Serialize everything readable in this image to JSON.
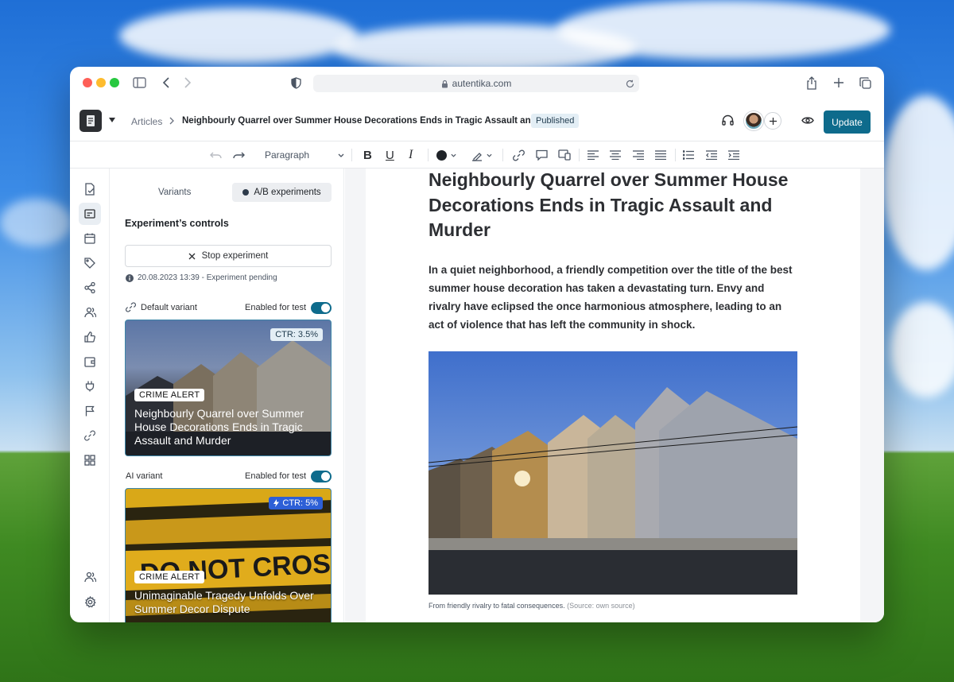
{
  "browser": {
    "url": "autentika.com"
  },
  "header": {
    "breadcrumb_root": "Articles",
    "article_title": "Neighbourly Quarrel over Summer House Decorations Ends in Tragic Assault and Murder",
    "status_badge": "Published",
    "update_label": "Update"
  },
  "toolbar": {
    "paragraph_style": "Paragraph",
    "text_color": "#1f2328"
  },
  "panel": {
    "tab_variants": "Variants",
    "tab_ab": "A/B experiments",
    "controls_title": "Experiment’s controls",
    "stop_label": "Stop experiment",
    "status_info": "20.08.2023 13:39 - Experiment pending",
    "default_variant": {
      "label": "Default variant",
      "enabled_label": "Enabled for test",
      "enabled": true,
      "ctr": "CTR: 3.5%",
      "tag": "CRIME ALERT",
      "title": "Neighbourly Quarrel over Summer House Decorations Ends in Tragic Assault and Murder"
    },
    "ai_variant": {
      "label": "AI variant",
      "enabled_label": "Enabled for test",
      "enabled": true,
      "ctr": "CTR: 5%",
      "tag": "CRIME ALERT",
      "title": "Unimaginable Tragedy Unfolds Over Summer Decor Dispute"
    }
  },
  "article": {
    "headline": "Neighbourly Quarrel over Summer House Decorations Ends in Tragic Assault and Murder",
    "lead": "In a quiet neighborhood, a friendly competition over the title of the best summer house decoration has taken a devastating turn. Envy and rivalry have eclipsed the once harmonious atmosphere, leading to an act of violence that has left the community in shock.",
    "caption": "From friendly rivalry to fatal consequences.",
    "caption_source": "(Source: own source)"
  },
  "colors": {
    "accent": "#0e6b8c",
    "status_badge_bg": "#e3eef5",
    "ctr_ai_bg": "#2d5fd6"
  }
}
